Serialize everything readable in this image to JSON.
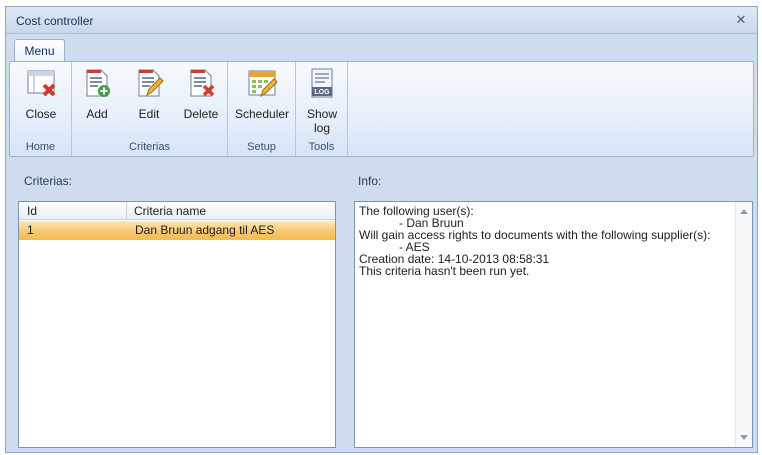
{
  "window": {
    "title": "Cost controller"
  },
  "ribbon": {
    "tab": "Menu",
    "groups": [
      {
        "label": "Home",
        "buttons": [
          {
            "label": "Close",
            "icon": "close-document-icon"
          }
        ]
      },
      {
        "label": "Criterias",
        "buttons": [
          {
            "label": "Add",
            "icon": "add-document-icon"
          },
          {
            "label": "Edit",
            "icon": "edit-document-icon"
          },
          {
            "label": "Delete",
            "icon": "delete-document-icon"
          }
        ]
      },
      {
        "label": "Setup",
        "buttons": [
          {
            "label": "Scheduler",
            "icon": "scheduler-icon"
          }
        ]
      },
      {
        "label": "Tools",
        "buttons": [
          {
            "label": "Show\nlog",
            "icon": "log-icon"
          }
        ]
      }
    ]
  },
  "icon_badge": "LOG",
  "criterias": {
    "label": "Criterias:",
    "columns": [
      "Id",
      "Criteria name"
    ],
    "rows": [
      {
        "id": "1",
        "name": "Dan Bruun adgang til AES",
        "selected": true
      }
    ]
  },
  "info": {
    "label": "Info:",
    "lines": [
      "The following user(s):",
      "            - Dan Bruun",
      "Will gain access rights to documents with the following supplier(s):",
      "            - AES",
      "Creation date: 14-10-2013 08:58:31",
      "This criteria hasn't been run yet."
    ]
  },
  "colors": {
    "selection": "#f8c871",
    "ribbon": "#dfe8f5",
    "frame": "#cfdcee"
  }
}
